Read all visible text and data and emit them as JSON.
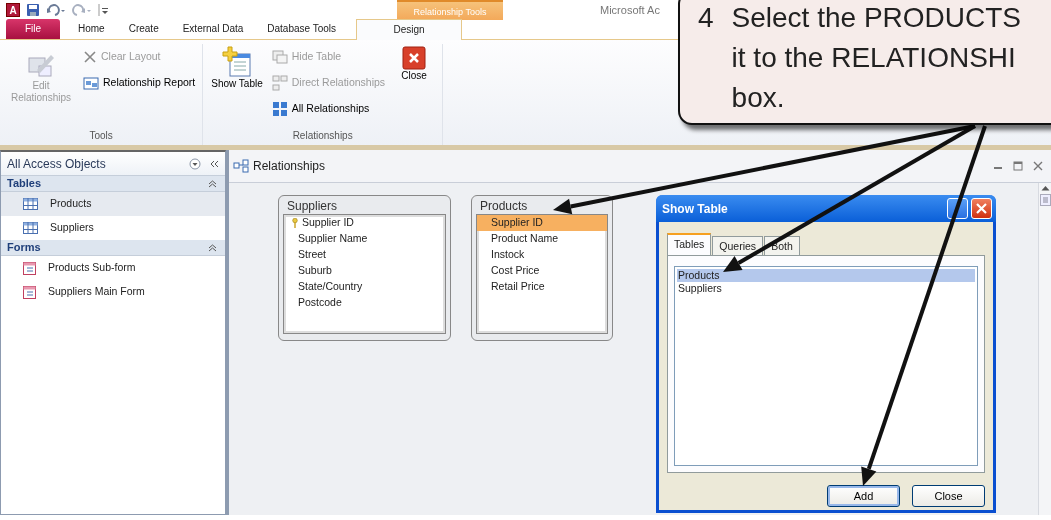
{
  "title_bar": {
    "logo": "A",
    "context_tab": "Relationship Tools",
    "app_title": "Microsoft Ac"
  },
  "ribbon": {
    "tabs": [
      {
        "label": "File",
        "kind": "file",
        "selected": false
      },
      {
        "label": "Home",
        "kind": "tab",
        "selected": false
      },
      {
        "label": "Create",
        "kind": "tab",
        "selected": false
      },
      {
        "label": "External Data",
        "kind": "tab",
        "selected": false
      },
      {
        "label": "Database Tools",
        "kind": "tab",
        "selected": false
      },
      {
        "label": "Design",
        "kind": "tab",
        "selected": true
      }
    ],
    "groups": [
      {
        "label": "Tools",
        "commands": [
          {
            "label": "Edit Relationships",
            "kind": "large",
            "disabled": true
          },
          {
            "label": "Clear Layout",
            "kind": "small",
            "disabled": true
          },
          {
            "label": "Relationship Report",
            "kind": "small",
            "disabled": false
          }
        ]
      },
      {
        "label": "Relationships",
        "commands": [
          {
            "label": "Show Table",
            "kind": "large",
            "disabled": false
          },
          {
            "label": "Hide Table",
            "kind": "small",
            "disabled": true
          },
          {
            "label": "Direct Relationships",
            "kind": "small",
            "disabled": true
          },
          {
            "label": "All Relationships",
            "kind": "small",
            "disabled": false
          },
          {
            "label": "Close",
            "kind": "large",
            "disabled": false
          }
        ]
      }
    ]
  },
  "nav_pane": {
    "title": "All Access Objects",
    "sections": [
      {
        "label": "Tables",
        "expanded": true,
        "items": [
          {
            "label": "Products",
            "kind": "table",
            "selected": true
          },
          {
            "label": "Suppliers",
            "kind": "table",
            "selected": false
          }
        ]
      },
      {
        "label": "Forms",
        "expanded": true,
        "items": [
          {
            "label": "Products Sub-form",
            "kind": "form",
            "selected": false
          },
          {
            "label": "Suppliers Main Form",
            "kind": "form",
            "selected": false
          }
        ]
      }
    ]
  },
  "document": {
    "tab": "Relationships",
    "tables": [
      {
        "title": "Suppliers",
        "fields": [
          {
            "label": "Supplier ID",
            "key": true,
            "selected": false
          },
          {
            "label": "Supplier Name",
            "key": false,
            "selected": false
          },
          {
            "label": "Street",
            "key": false,
            "selected": false
          },
          {
            "label": "Suburb",
            "key": false,
            "selected": false
          },
          {
            "label": "State/Country",
            "key": false,
            "selected": false
          },
          {
            "label": "Postcode",
            "key": false,
            "selected": false
          }
        ]
      },
      {
        "title": "Products",
        "fields": [
          {
            "label": "Supplier ID",
            "key": false,
            "selected": true
          },
          {
            "label": "Product Name",
            "key": false,
            "selected": false
          },
          {
            "label": "Instock",
            "key": false,
            "selected": false
          },
          {
            "label": "Cost Price",
            "key": false,
            "selected": false
          },
          {
            "label": "Retail Price",
            "key": false,
            "selected": false
          }
        ]
      }
    ]
  },
  "dialog": {
    "title": "Show Table",
    "tabs": [
      {
        "label": "Tables",
        "selected": true
      },
      {
        "label": "Queries",
        "selected": false
      },
      {
        "label": "Both",
        "selected": false
      }
    ],
    "items": [
      {
        "label": "Products",
        "selected": true
      },
      {
        "label": "Suppliers",
        "selected": false
      }
    ],
    "buttons": [
      {
        "label": "Add",
        "default": true
      },
      {
        "label": "Close",
        "default": false
      }
    ]
  },
  "callout": {
    "number": "4",
    "lines": [
      "Select the PRODUCTS",
      "it to the RELATIONSHI",
      "box."
    ]
  }
}
